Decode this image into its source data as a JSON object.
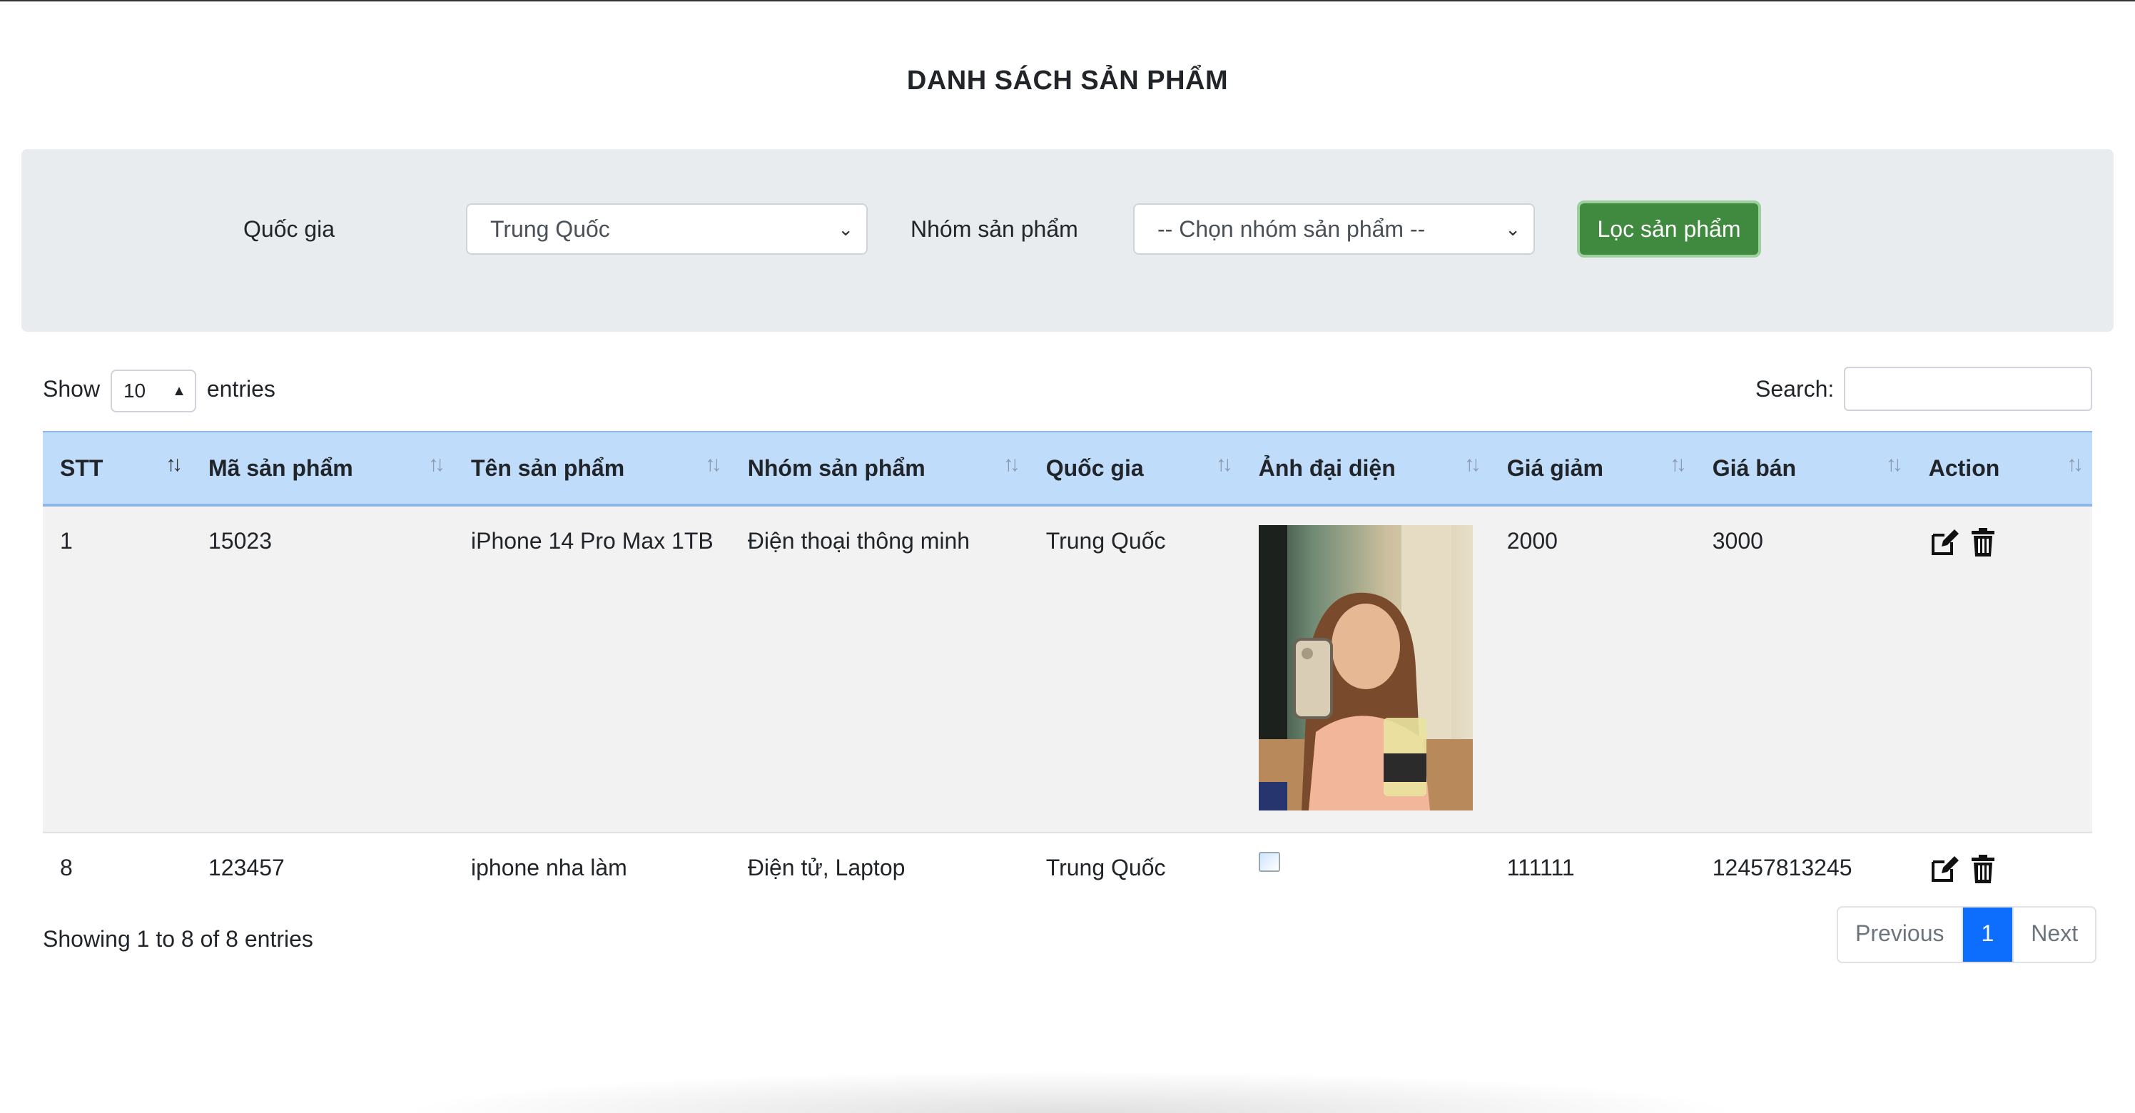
{
  "page": {
    "title": "DANH SÁCH SẢN PHẨM"
  },
  "filter": {
    "country_label": "Quốc gia",
    "country_value": "Trung Quốc",
    "group_label": "Nhóm sản phẩm",
    "group_value": "-- Chọn nhóm sản phẩm --",
    "button_label": "Lọc sản phẩm",
    "button_color": "#3f8a3f"
  },
  "table_controls": {
    "show_label": "Show",
    "entries_value": "10",
    "entries_label": "entries",
    "search_label": "Search:",
    "search_value": ""
  },
  "table": {
    "headers": [
      "STT",
      "Mã sản phẩm",
      "Tên sản phẩm",
      "Nhóm sản phẩm",
      "Quốc gia",
      "Ảnh đại diện",
      "Giá giảm",
      "Giá bán",
      "Action"
    ],
    "header_color": "#bfdcfb",
    "rows": [
      {
        "stt": "1",
        "code": "15023",
        "name": "iPhone 14 Pro Max 1TB",
        "group": "Điện thoại thông minh",
        "country": "Trung Quốc",
        "image": "photo",
        "discount_price": "2000",
        "price": "3000"
      },
      {
        "stt": "8",
        "code": "123457",
        "name": "iphone nha làm",
        "group": "Điện tử, Laptop",
        "country": "Trung Quốc",
        "image": "broken-image",
        "discount_price": "111111",
        "price": "12457813245"
      }
    ]
  },
  "footer": {
    "info": "Showing 1 to 8 of 8 entries",
    "previous": "Previous",
    "current_page": "1",
    "next": "Next",
    "active_color": "#0d6efd"
  }
}
